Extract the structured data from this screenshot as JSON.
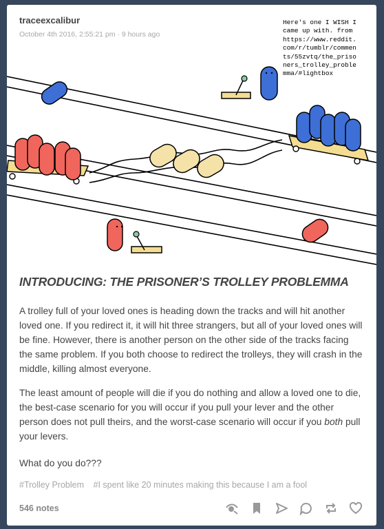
{
  "post": {
    "username": "traceexcalibur",
    "timestamp": "October 4th 2016, 2:55:21 pm · 9 hours ago",
    "image_caption": "Here's one I WISH I\ncame up with. from\nhttps://www.reddit.\ncom/r/tumblr/commen\nts/55zvtq/the_priso\nners_trolley_proble\nmma/#lightbox",
    "heading": "INTRODUCING: THE PRISONER’S TROLLEY PROBLEMMA",
    "paragraph1": "A trolley full of your loved ones is heading down the tracks and will hit another loved one. If you redirect it, it will hit three strangers, but all of your loved ones will be fine. However, there is another person on the other side of the tracks facing the same problem. If you both choose to redirect the trolleys, they will crash in the middle, killing almost everyone.",
    "paragraph2_before": "The least amount of people will die if you do nothing and allow a loved one to die, the best-case scenario for you will occur if you pull your lever and the other person does not pull theirs, and the worst-case scenario will occur if you ",
    "paragraph2_emph": "both",
    "paragraph2_after": " pull your levers.",
    "paragraph3": "What do you do???",
    "tags": [
      "#Trolley Problem",
      "#I spent like 20 minutes making this because I am a fool"
    ],
    "notes": "546 notes"
  },
  "actions": [
    {
      "icon": "eye-icon"
    },
    {
      "icon": "bookmark-icon"
    },
    {
      "icon": "share-icon"
    },
    {
      "icon": "reply-icon"
    },
    {
      "icon": "reblog-icon"
    },
    {
      "icon": "heart-icon"
    }
  ],
  "colors": {
    "background": "#36465d",
    "card": "#ffffff",
    "red_person": "#f0665c",
    "blue_person": "#3d6fd6",
    "stranger": "#f4e2a8",
    "cart": "#f4dc91"
  }
}
